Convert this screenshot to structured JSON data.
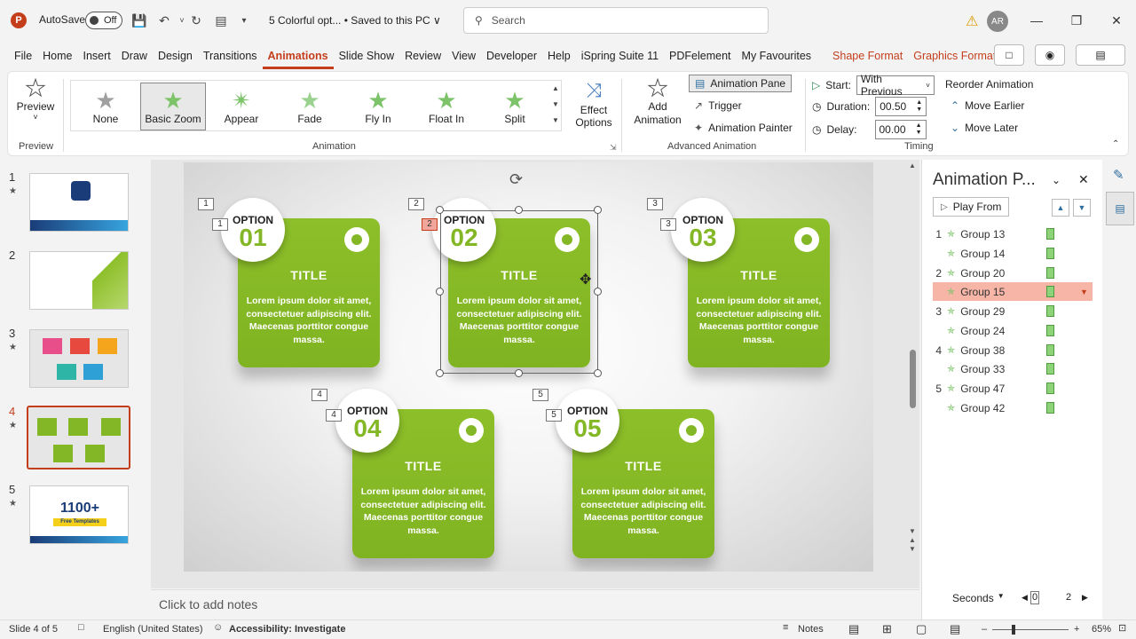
{
  "titlebar": {
    "autosave_label": "AutoSave",
    "autosave_state": "Off",
    "doc_title": "5 Colorful opt... • Saved to this PC ∨",
    "search_placeholder": "Search",
    "user_initials": "AR"
  },
  "menu": {
    "tabs": [
      "File",
      "Home",
      "Insert",
      "Draw",
      "Design",
      "Transitions",
      "Animations",
      "Slide Show",
      "Review",
      "View",
      "Developer",
      "Help",
      "iSpring Suite 11",
      "PDFelement",
      "My Favourites"
    ],
    "active_tab": "Animations",
    "contextual_tabs": [
      "Shape Format",
      "Graphics Format"
    ]
  },
  "ribbon": {
    "preview": {
      "label": "Preview",
      "group": "Preview"
    },
    "animation_gallery": [
      "None",
      "Basic Zoom",
      "Appear",
      "Fade",
      "Fly In",
      "Float In",
      "Split"
    ],
    "selected_animation": "Basic Zoom",
    "effect_options": "Effect Options",
    "animation_group": "Animation",
    "add_animation": "Add Animation",
    "animation_pane": "Animation Pane",
    "trigger": "Trigger",
    "animation_painter": "Animation Painter",
    "advanced_group": "Advanced Animation",
    "start_label": "Start:",
    "start_value": "With Previous",
    "duration_label": "Duration:",
    "duration_value": "00.50",
    "delay_label": "Delay:",
    "delay_value": "00.00",
    "timing_group": "Timing",
    "reorder": "Reorder Animation",
    "move_earlier": "Move Earlier",
    "move_later": "Move Later"
  },
  "thumbnails": [
    {
      "num": "1",
      "starred": true
    },
    {
      "num": "2",
      "starred": false
    },
    {
      "num": "3",
      "starred": true
    },
    {
      "num": "4",
      "starred": true,
      "active": true
    },
    {
      "num": "5",
      "starred": true,
      "text": "1100+",
      "subtext": "Free Templates"
    }
  ],
  "slide": {
    "cards": [
      {
        "option": "OPTION",
        "number": "01",
        "title": "TITLE",
        "body": "Lorem ipsum dolor sit amet, consectetuer adipiscing elit. Maecenas porttitor congue massa.",
        "tag": "1"
      },
      {
        "option": "OPTION",
        "number": "02",
        "title": "TITLE",
        "body": "Lorem ipsum dolor sit amet, consectetuer adipiscing elit. Maecenas porttitor congue massa.",
        "tag": "2"
      },
      {
        "option": "OPTION",
        "number": "03",
        "title": "TITLE",
        "body": "Lorem ipsum dolor sit amet, consectetuer adipiscing elit. Maecenas porttitor congue massa.",
        "tag": "3"
      },
      {
        "option": "OPTION",
        "number": "04",
        "title": "TITLE",
        "body": "Lorem ipsum dolor sit amet, consectetuer adipiscing elit. Maecenas porttitor congue massa.",
        "tag": "4"
      },
      {
        "option": "OPTION",
        "number": "05",
        "title": "TITLE",
        "body": "Lorem ipsum dolor sit amet, consectetuer adipiscing elit. Maecenas porttitor congue massa.",
        "tag": "5"
      }
    ],
    "accent": "#84b726"
  },
  "notes_placeholder": "Click to add notes",
  "animation_pane": {
    "title": "Animation P...",
    "play_from": "Play From",
    "items": [
      {
        "num": "1",
        "name": "Group 13"
      },
      {
        "num": "",
        "name": "Group 14"
      },
      {
        "num": "2",
        "name": "Group 20"
      },
      {
        "num": "",
        "name": "Group 15",
        "selected": true
      },
      {
        "num": "3",
        "name": "Group 29"
      },
      {
        "num": "",
        "name": "Group 24"
      },
      {
        "num": "4",
        "name": "Group 38"
      },
      {
        "num": "",
        "name": "Group 33"
      },
      {
        "num": "5",
        "name": "Group 47"
      },
      {
        "num": "",
        "name": "Group 42"
      }
    ],
    "timeline_unit": "Seconds",
    "timeline_start": "0",
    "timeline_end": "2"
  },
  "status": {
    "slide_info": "Slide 4 of 5",
    "language": "English (United States)",
    "accessibility": "Accessibility: Investigate",
    "notes": "Notes",
    "zoom": "65%"
  }
}
